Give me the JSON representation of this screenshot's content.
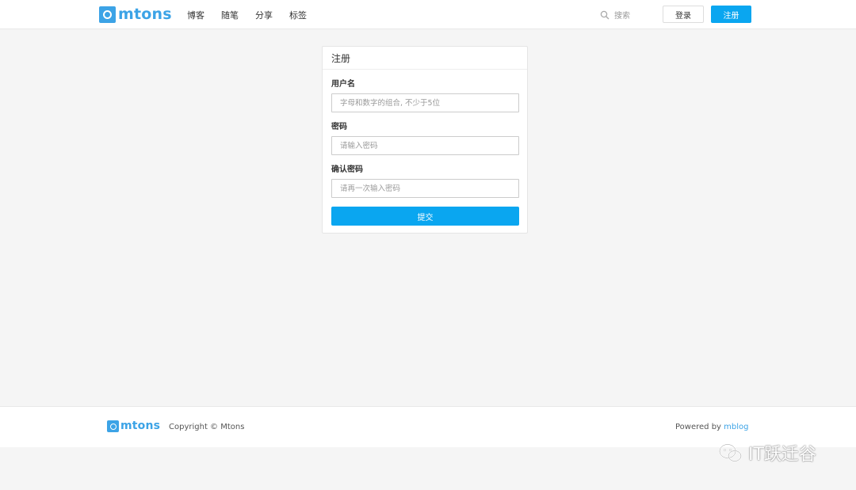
{
  "brand": {
    "logo_text": "mtons"
  },
  "nav": {
    "items": [
      "博客",
      "随笔",
      "分享",
      "标签"
    ]
  },
  "search": {
    "placeholder": "搜索"
  },
  "header_buttons": {
    "login": "登录",
    "register": "注册"
  },
  "form": {
    "title": "注册",
    "fields": [
      {
        "label": "用户名",
        "placeholder": "字母和数字的组合, 不少于5位"
      },
      {
        "label": "密码",
        "placeholder": "请输入密码"
      },
      {
        "label": "确认密码",
        "placeholder": "请再一次输入密码"
      }
    ],
    "submit_label": "提交"
  },
  "footer": {
    "logo_text": "mtons",
    "copyright": "Copyright © Mtons",
    "powered_prefix": "Powered by ",
    "powered_link": "mblog"
  },
  "watermark": {
    "text": "IT跃迁谷"
  },
  "colors": {
    "accent": "#0aa6f0",
    "logo": "#3ca3e6",
    "background": "#f5f5f5"
  }
}
